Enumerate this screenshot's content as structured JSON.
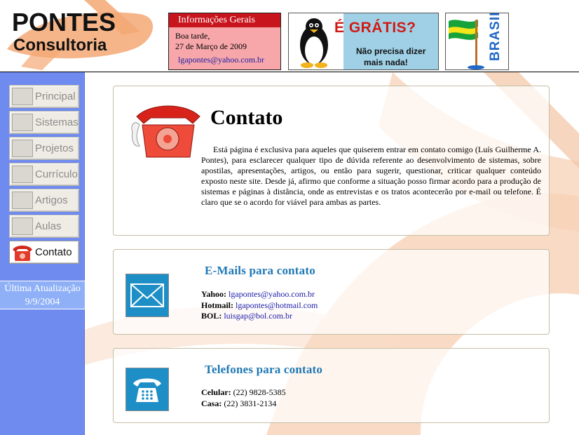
{
  "header": {
    "logo_title": "PONTES",
    "logo_subtitle": "Consultoria",
    "info_box": {
      "title": "Informações Gerais",
      "greeting": "Boa tarde,",
      "date": "27 de Março de 2009",
      "email": "lgapontes@yahoo.com.br"
    },
    "gratis_banner": {
      "title": "É GRÁTIS?",
      "line1": "Não precisa dizer",
      "line2": "mais nada!",
      "icon": "tux-penguin-icon"
    },
    "brasil_banner": {
      "text": "BRASIL",
      "icon": "brazil-flag-icon"
    }
  },
  "sidebar": {
    "items": [
      {
        "label": "Principal",
        "icon": "principal-thumb-icon",
        "active": false
      },
      {
        "label": "Sistemas",
        "icon": "sistemas-thumb-icon",
        "active": false
      },
      {
        "label": "Projetos",
        "icon": "projetos-thumb-icon",
        "active": false
      },
      {
        "label": "Currículo",
        "icon": "curriculo-thumb-icon",
        "active": false
      },
      {
        "label": "Artigos",
        "icon": "artigos-thumb-icon",
        "active": false
      },
      {
        "label": "Aulas",
        "icon": "aulas-thumb-icon",
        "active": false
      },
      {
        "label": "Contato",
        "icon": "red-telephone-icon",
        "active": true
      }
    ],
    "update_label": "Última Atualização",
    "update_date": "9/9/2004"
  },
  "main": {
    "title": "Contato",
    "intro": "Está página é exclusiva para aqueles que quiserem entrar em contato comigo (Luís Guilherme A. Pontes), para esclarecer qualquer tipo de dúvida referente ao desenvolvimento de sistemas, sobre apostilas, apresentações, artigos, ou então para sugerir, questionar, criticar qualquer conteúdo exposto neste site. Desde já, afirmo que conforme a situação posso firmar acordo para a produção de sistemas e páginas à distância, onde as entrevistas e os tratos acontecerão por e-mail ou telefone. É claro que se o acordo for viável para ambas as partes.",
    "emails": {
      "title": "E-Mails para contato",
      "icon": "envelope-icon",
      "items": [
        {
          "label": "Yahoo:",
          "value": "lgapontes@yahoo.com.br"
        },
        {
          "label": "Hotmail:",
          "value": "lgapontes@hotmail.com"
        },
        {
          "label": "BOL:",
          "value": "luisgap@bol.com.br"
        }
      ]
    },
    "phones": {
      "title": "Telefones para contato",
      "icon": "telephone-icon",
      "items": [
        {
          "label": "Celular:",
          "value": "(22) 9828-5385"
        },
        {
          "label": "Casa:",
          "value": "(22) 3831-2134"
        }
      ]
    }
  },
  "colors": {
    "sidebar": "#6f8bef",
    "info_title": "#c8141c",
    "info_bg": "#f7a7a9",
    "section_title": "#1f78b4",
    "link": "#1a1aa8",
    "watermark": "#f4c4a4"
  }
}
